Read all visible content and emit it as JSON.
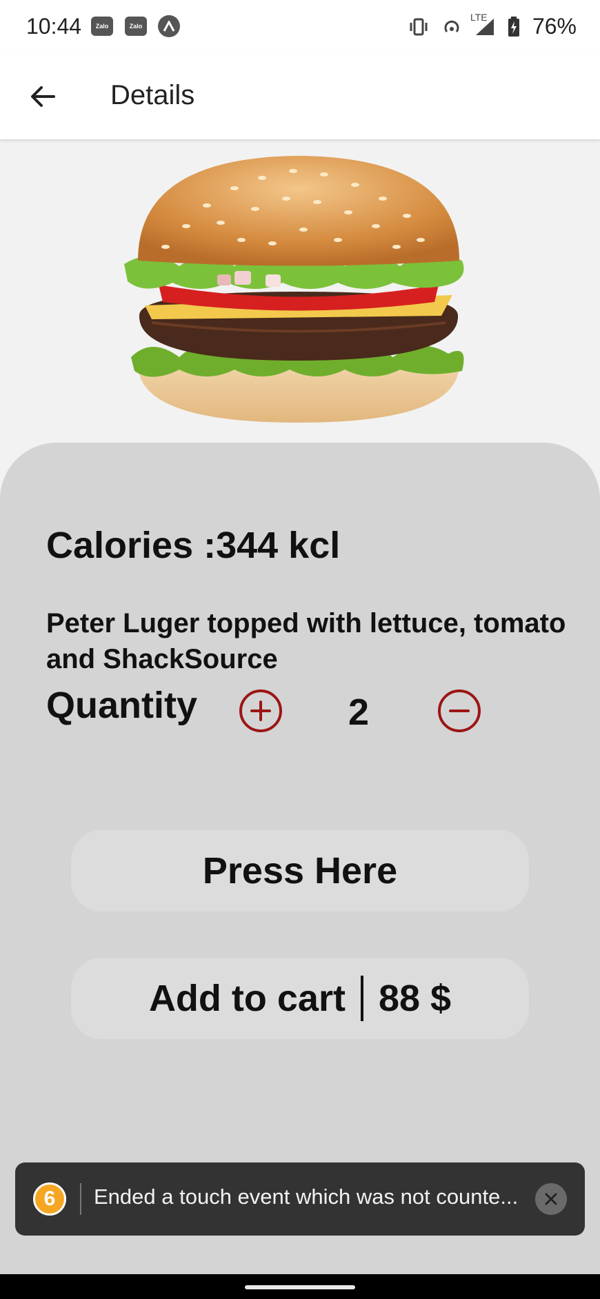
{
  "status_bar": {
    "time": "10:44",
    "notif_icons": [
      "Zalo",
      "Zalo"
    ],
    "network_label": "LTE",
    "battery": "76%"
  },
  "app_bar": {
    "title": "Details"
  },
  "product": {
    "calories": "Calories :344 kcl",
    "description": "Peter Luger topped with lettuce, tomato and ShackSource",
    "quantity_label": "Quantity",
    "quantity_value": "2"
  },
  "buttons": {
    "press_here": "Press Here",
    "add_to_cart": "Add to cart",
    "price": "88 $"
  },
  "toast": {
    "badge": "6",
    "message": "Ended a touch event which was not counte..."
  },
  "colors": {
    "accent": "#9c1515",
    "card": "#d4d4d4",
    "toast_bg": "#333333",
    "badge": "#f5a623"
  }
}
